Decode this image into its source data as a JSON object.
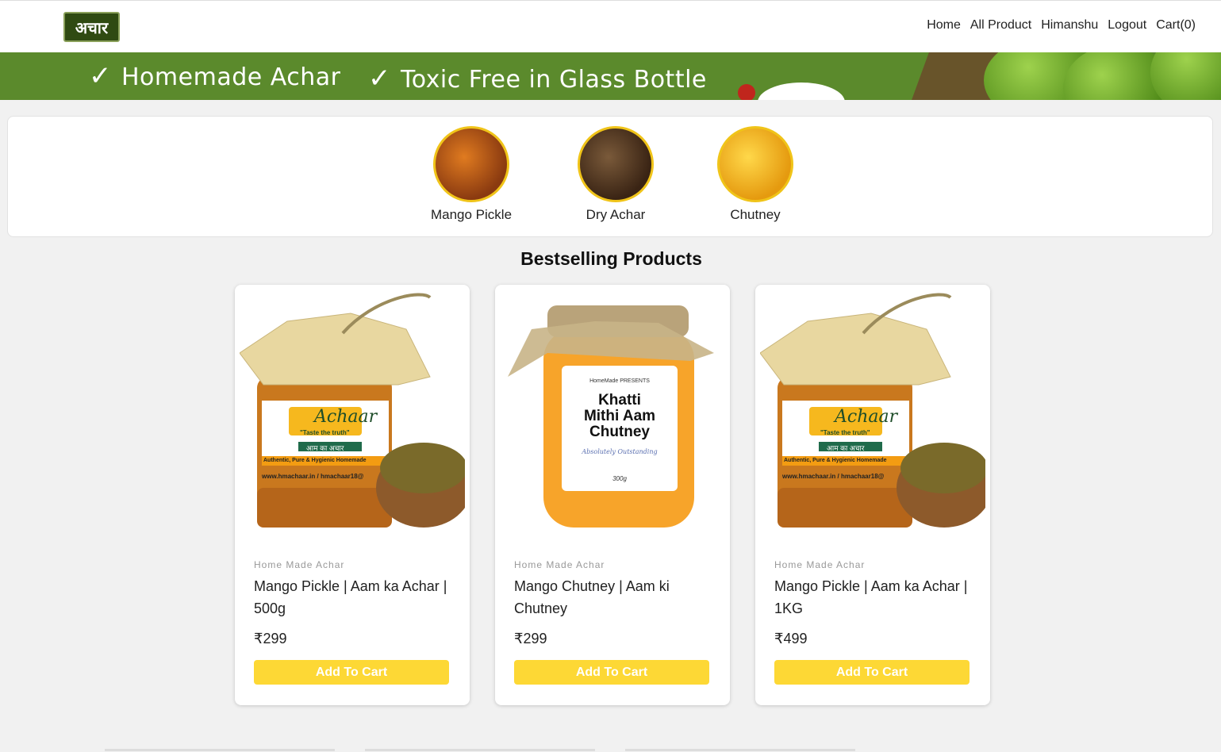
{
  "header": {
    "logo_text": "अचार",
    "nav": [
      {
        "label": "Home"
      },
      {
        "label": "All Product"
      },
      {
        "label": "Himanshu"
      },
      {
        "label": "Logout"
      },
      {
        "label": "Cart(0)"
      }
    ]
  },
  "banner": {
    "slogan1": "Homemade Achar",
    "slogan2": "Toxic Free in Glass Bottle",
    "check": "✓"
  },
  "categories": [
    {
      "label": "Mango Pickle"
    },
    {
      "label": "Dry Achar"
    },
    {
      "label": "Chutney"
    }
  ],
  "section_title": "Bestselling Products",
  "products": [
    {
      "brand": "Home Made Achar",
      "name": "Mango Pickle | Aam ka Achar | 500g",
      "price": "₹299",
      "button": "Add To Cart",
      "label": {
        "title": "Achaar",
        "tagline": "\"Taste the truth\"",
        "hindi": "आम का अचार",
        "desc": "Authentic, Pure & Hygienic Homemade",
        "url": "www.hmachaar.in / hmachaar18@"
      }
    },
    {
      "brand": "Home Made Achar",
      "name": "Mango Chutney | Aam ki Chutney",
      "price": "₹299",
      "button": "Add To Cart",
      "label": {
        "presents": "HomeMade PRESENTS",
        "line1": "Khatti",
        "line2": "Mithi Aam",
        "line3": "Chutney",
        "sign": "Absolutely Outstanding",
        "weight": "300g"
      }
    },
    {
      "brand": "Home Made Achar",
      "name": "Mango Pickle | Aam ka Achar | 1KG",
      "price": "₹499",
      "button": "Add To Cart",
      "label": {
        "title": "Achaar",
        "tagline": "\"Taste the truth\"",
        "hindi": "आम का अचार",
        "desc": "Authentic, Pure & Hygienic Homemade",
        "url": "www.hmachaar.in / hmachaar18@"
      }
    }
  ],
  "colors": {
    "banner_green": "#5b8a2c",
    "button_yellow": "#fdd835",
    "logo_green": "#2f4a12"
  }
}
